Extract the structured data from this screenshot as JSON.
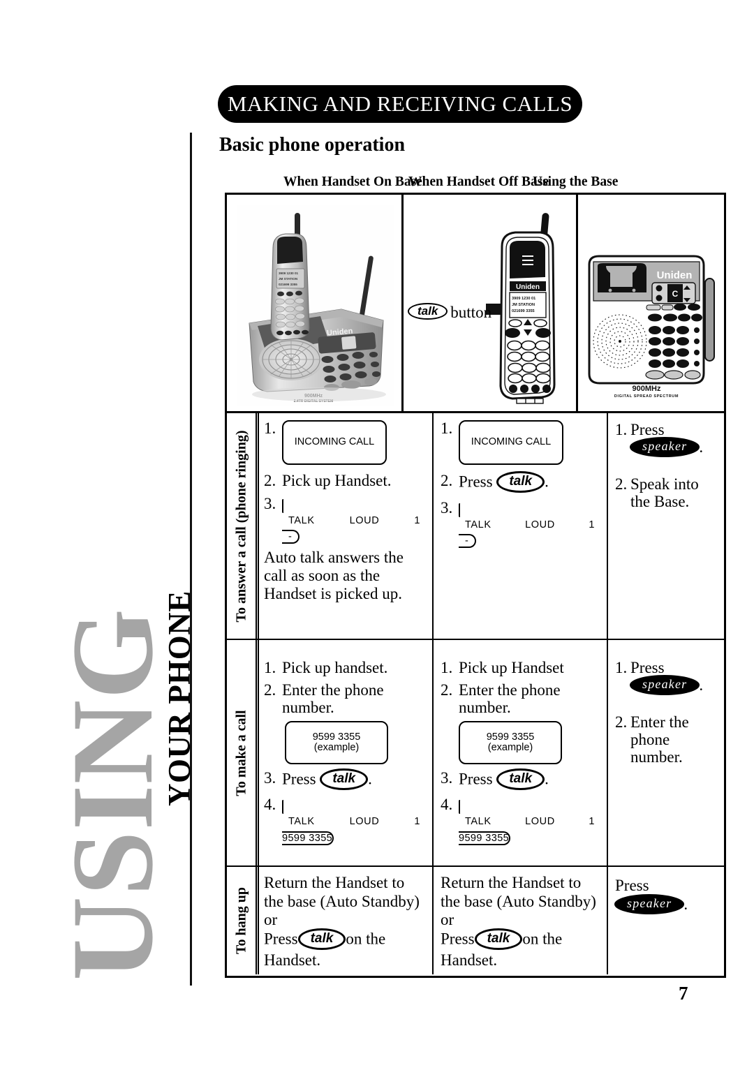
{
  "sidebar": {
    "big_word": "USING",
    "small_word": "YOUR PHONE"
  },
  "header": {
    "title": "MAKING AND RECEIVING CALLS",
    "section_heading": "Basic phone operation"
  },
  "table": {
    "column_headers": [
      "When Handset On Base",
      "When Handset Off Base",
      "Using the Base"
    ],
    "row_labels": [
      "To answer a call (phone ringing)",
      "To make a call",
      "To hang up"
    ],
    "images": {
      "on_base": {
        "caption_brand": "Uniden",
        "caption_freq": "900MHz",
        "caption_sub": "2.4TR DIGITAL SYSTEM"
      },
      "off_base": {
        "callout_button": "talk",
        "callout_text": "button",
        "brand": "Uniden",
        "lcd_line1_left": "3909",
        "lcd_line1_mid": "1230",
        "lcd_line1_right": "01",
        "lcd_line2": "JM STATION",
        "lcd_line3": "021699 3355"
      },
      "using_base": {
        "brand": "Uniden",
        "freq": "900MHz",
        "sub": "DIGITAL SPREAD SPECTRUM"
      }
    },
    "answer_call": {
      "on_base": {
        "steps": [
          {
            "num": "1.",
            "type": "lcd_incoming",
            "lcd": "INCOMING CALL"
          },
          {
            "num": "2.",
            "type": "text",
            "text": "Pick up Handset."
          },
          {
            "num": "3.",
            "type": "lcd_talkloud",
            "lcd_left": "TALK",
            "lcd_mid": "LOUD",
            "lcd_right": "1",
            "lcd_sub": "-"
          }
        ],
        "note": "Auto talk answers the call as soon as the Handset is picked up."
      },
      "off_base": {
        "steps": [
          {
            "num": "1.",
            "type": "lcd_incoming",
            "lcd": "INCOMING CALL"
          },
          {
            "num": "2.",
            "type": "press_talk",
            "prefix": "Press",
            "button": "talk",
            "suffix": "."
          },
          {
            "num": "3.",
            "type": "lcd_talkloud",
            "lcd_left": "TALK",
            "lcd_mid": "LOUD",
            "lcd_right": "1",
            "lcd_sub": "-"
          }
        ]
      },
      "using_base": {
        "steps": [
          {
            "num": "1.",
            "type": "press_speaker",
            "prefix": "Press",
            "button": "speaker",
            "suffix": "."
          },
          {
            "num": "2.",
            "type": "text",
            "text": "Speak into the Base."
          }
        ]
      }
    },
    "make_call": {
      "on_base": {
        "steps": [
          {
            "num": "1.",
            "type": "text",
            "text": "Pick up handset."
          },
          {
            "num": "2.",
            "type": "text",
            "text": "Enter the phone number."
          },
          {
            "num": "",
            "type": "lcd_number",
            "lcd_line1": "9599 3355",
            "lcd_line2": "(example)"
          },
          {
            "num": "3.",
            "type": "press_talk",
            "prefix": "Press",
            "button": "talk",
            "suffix": "."
          },
          {
            "num": "4.",
            "type": "lcd_talknum",
            "lcd_left": "TALK",
            "lcd_mid": "LOUD",
            "lcd_right": "1",
            "lcd_sub": "9599 3355"
          }
        ]
      },
      "off_base": {
        "steps": [
          {
            "num": "1.",
            "type": "text",
            "text": "Pick up Handset"
          },
          {
            "num": "2.",
            "type": "text",
            "text": "Enter the phone number."
          },
          {
            "num": "",
            "type": "lcd_number",
            "lcd_line1": "9599 3355",
            "lcd_line2": "(example)"
          },
          {
            "num": "3.",
            "type": "press_talk",
            "prefix": "Press",
            "button": "talk",
            "suffix": "."
          },
          {
            "num": "4.",
            "type": "lcd_talknum",
            "lcd_left": "TALK",
            "lcd_mid": "LOUD",
            "lcd_right": "1",
            "lcd_sub": "9599 3355"
          }
        ]
      },
      "using_base": {
        "steps": [
          {
            "num": "1.",
            "type": "press_speaker",
            "prefix": "Press",
            "button": "speaker",
            "suffix": "."
          },
          {
            "num": "2.",
            "type": "text",
            "text": "Enter the phone number."
          }
        ]
      }
    },
    "hang_up": {
      "on_base": {
        "line1": "Return the Handset to the base (Auto Standby)",
        "line2": "or",
        "press_prefix": "Press",
        "press_button": "talk",
        "press_suffix": "on the Handset."
      },
      "off_base": {
        "line1": "Return the Handset to the base (Auto Standby)",
        "line2": "or",
        "press_prefix": "Press",
        "press_button": "talk",
        "press_suffix": "on the Handset."
      },
      "using_base": {
        "press_prefix": "Press",
        "press_button": "speaker",
        "press_suffix": "."
      }
    }
  },
  "footer": {
    "page_number": "7"
  }
}
